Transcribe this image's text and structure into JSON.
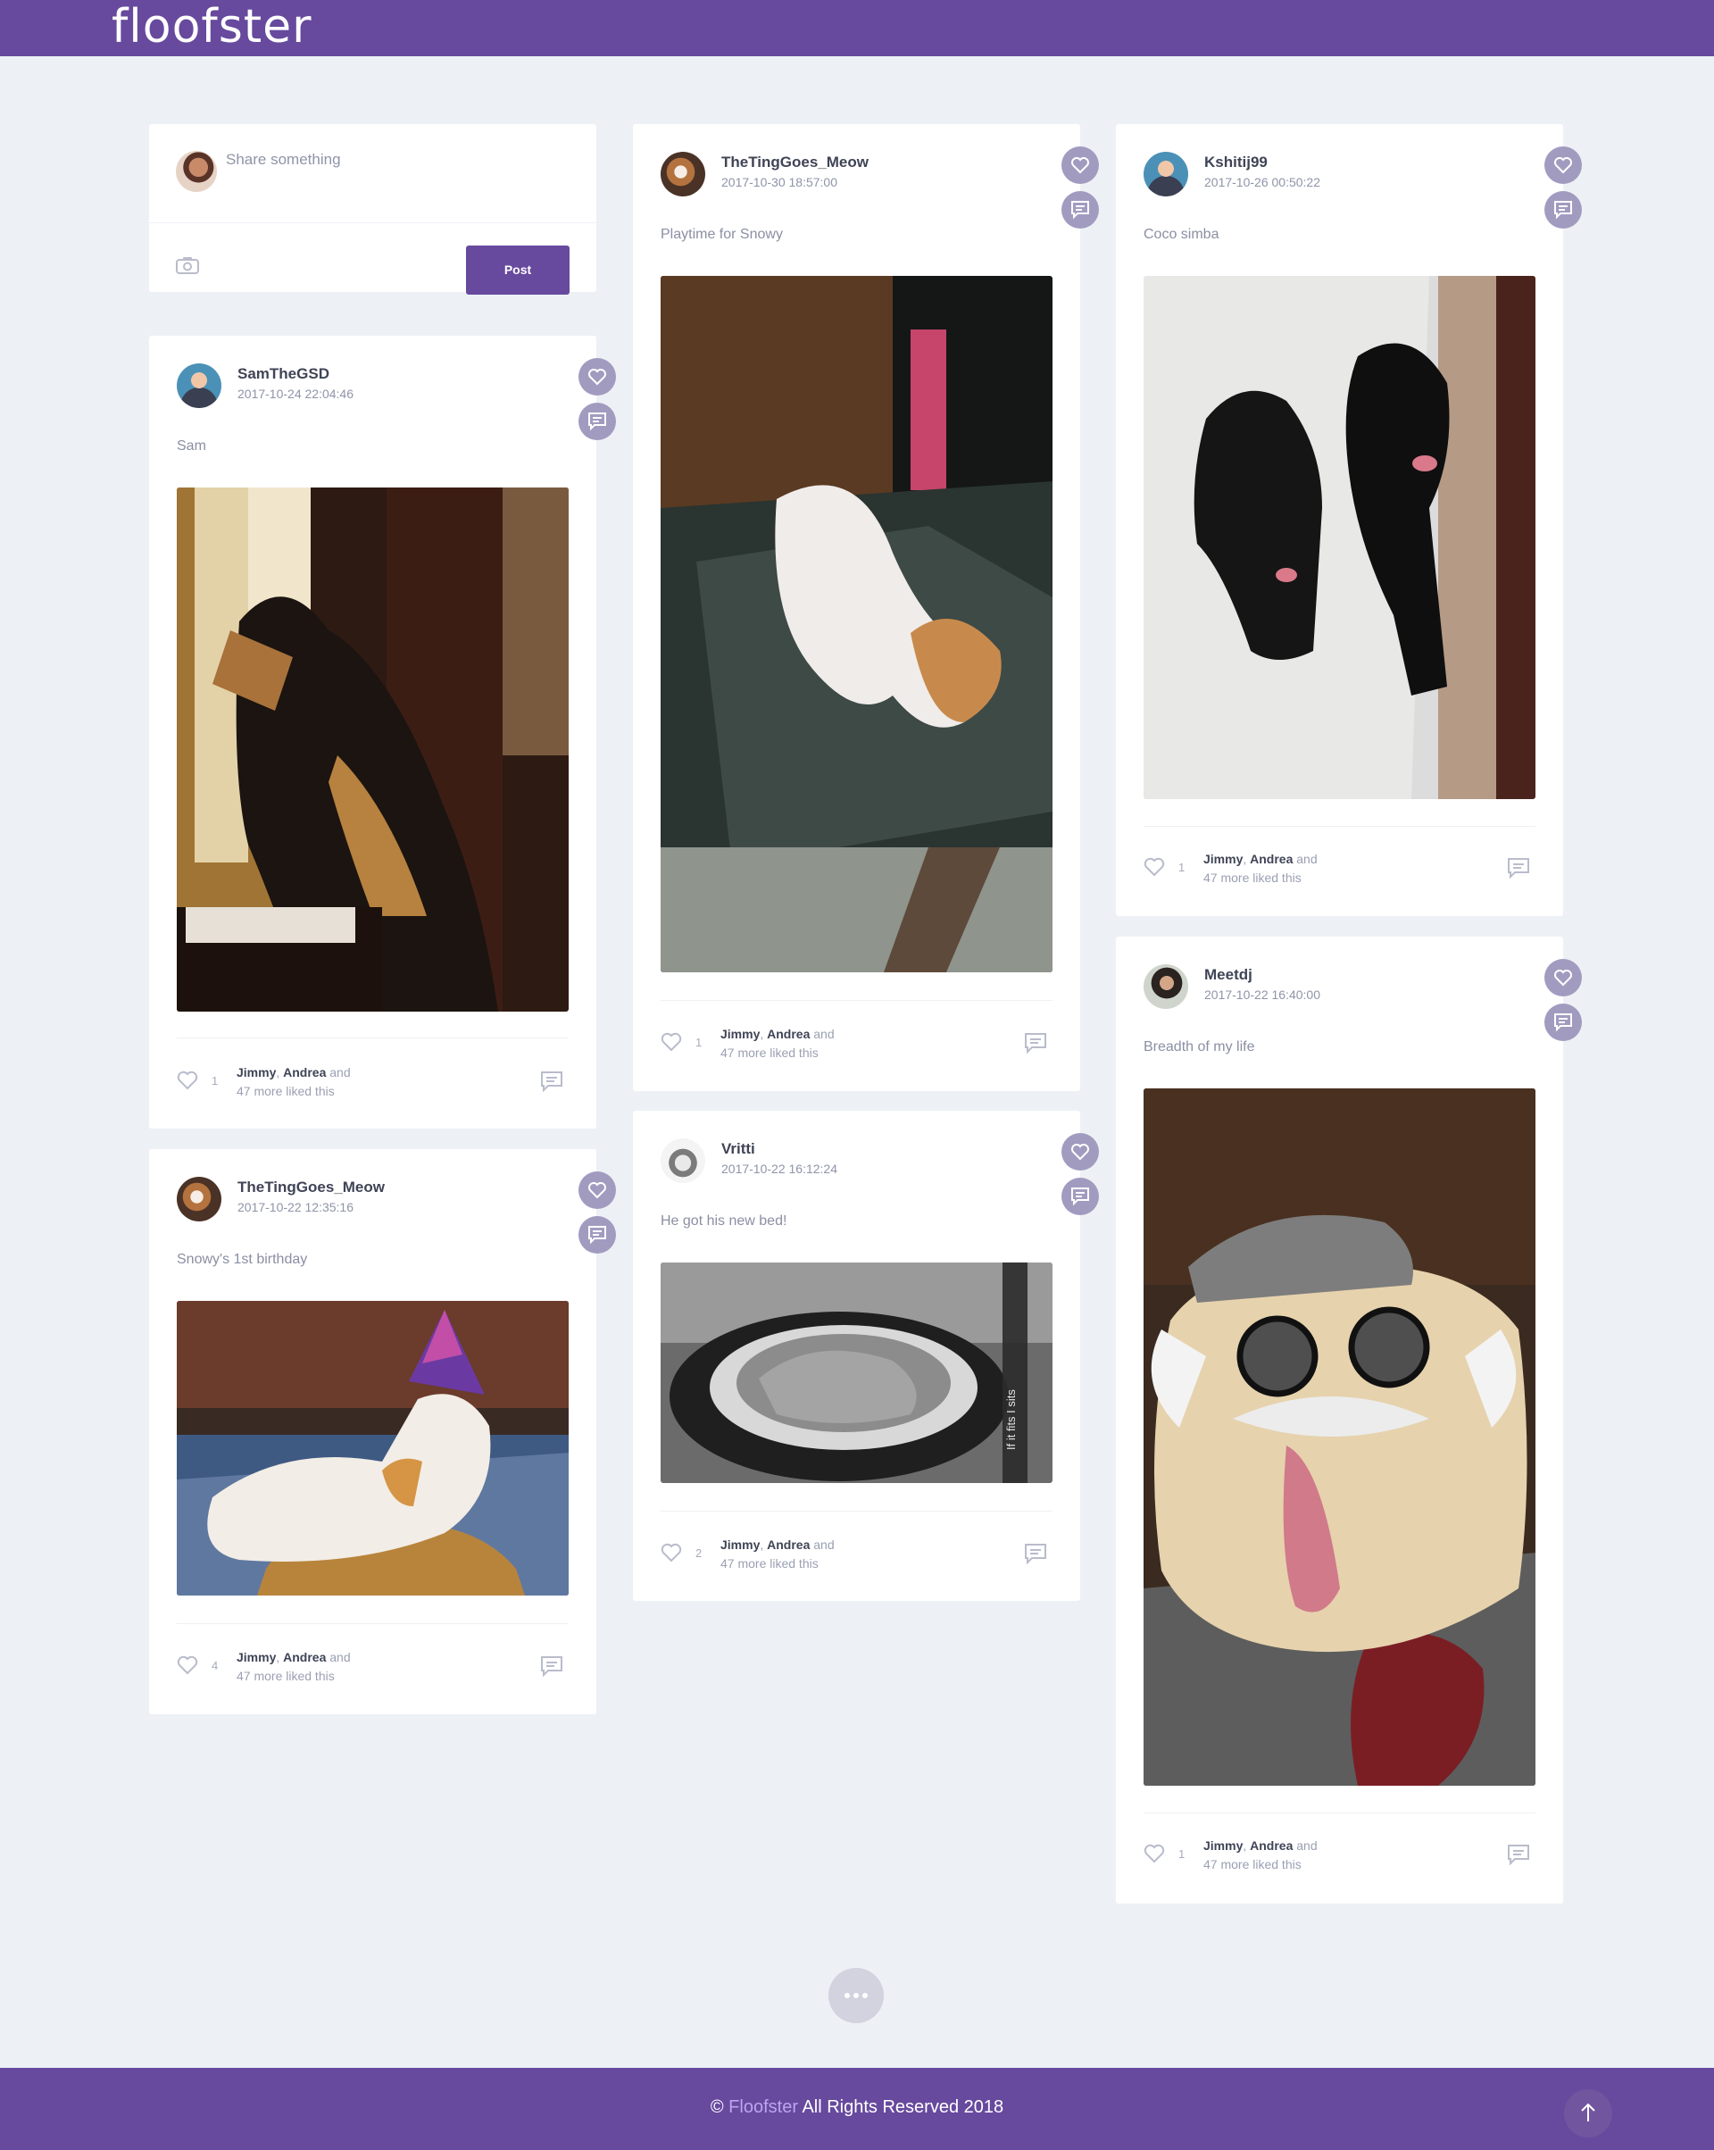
{
  "app": {
    "logo": "floofster"
  },
  "compose": {
    "placeholder": "Share something",
    "post_label": "Post"
  },
  "liked_by": {
    "name1": "Jimmy",
    "sep": ", ",
    "name2": "Andrea",
    "and": " and",
    "more": "47 more liked this"
  },
  "posts": [
    {
      "username": "SamTheGSD",
      "timestamp": "2017-10-24 22:04:46",
      "caption": "Sam",
      "likes": "1",
      "photo": "german-shepherd-at-window"
    },
    {
      "username": "TheTingGoes_Meow",
      "timestamp": "2017-10-22 12:35:16",
      "caption": "Snowy's 1st birthday",
      "likes": "4",
      "photo": "cat-with-party-hat"
    },
    {
      "username": "TheTingGoes_Meow",
      "timestamp": "2017-10-30 18:57:00",
      "caption": "Playtime for Snowy",
      "likes": "1",
      "photo": "blurry-white-kitten"
    },
    {
      "username": "Vritti",
      "timestamp": "2017-10-22 16:12:24",
      "caption": "He got his new bed!",
      "likes": "2",
      "photo": "cat-in-bed-grayscale",
      "overlay_text": "If it fits I sits"
    },
    {
      "username": "Kshitij99",
      "timestamp": "2017-10-26 00:50:22",
      "caption": "Coco simba",
      "likes": "1",
      "photo": "two-black-labradors"
    },
    {
      "username": "Meetdj",
      "timestamp": "2017-10-22 16:40:00",
      "caption": "Breadth of my life",
      "likes": "1",
      "photo": "pug-with-hat-and-glasses"
    }
  ],
  "footer": {
    "copyright": "©",
    "brand": "Floofster",
    "rights": " All Rights Reserved 2018"
  },
  "colors": {
    "brand": "#67499e",
    "background": "#edf1f5",
    "fab": "#a29bc0"
  }
}
